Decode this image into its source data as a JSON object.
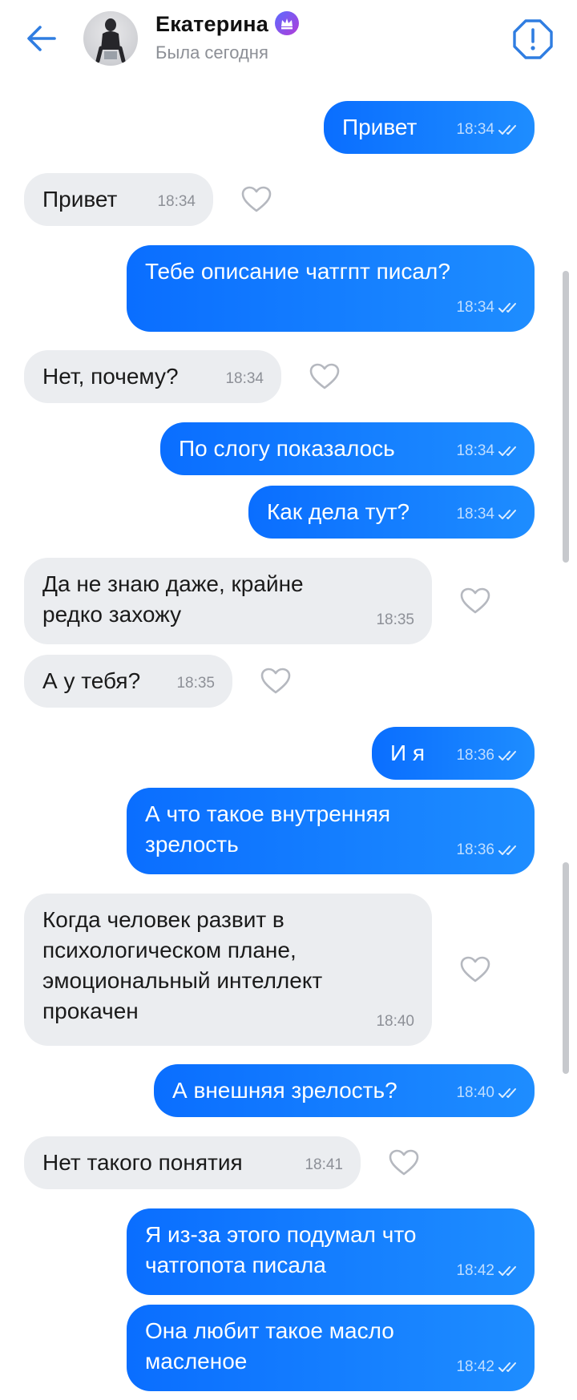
{
  "header": {
    "contact_name": "Екатерина",
    "status": "Была сегодня",
    "accent_color": "#2f7de1"
  },
  "messages": [
    {
      "dir": "out",
      "lines": [
        "Привет"
      ],
      "time": "18:34"
    },
    {
      "dir": "in",
      "lines": [
        "Привет"
      ],
      "time": "18:34"
    },
    {
      "dir": "out",
      "lines": [
        "Тебе описание чатгпт писал?"
      ],
      "time": "18:34"
    },
    {
      "dir": "in",
      "lines": [
        "Нет, почему?"
      ],
      "time": "18:34"
    },
    {
      "dir": "out",
      "lines": [
        "По слогу показалось"
      ],
      "time": "18:34"
    },
    {
      "dir": "out",
      "lines": [
        "Как дела тут?"
      ],
      "time": "18:34"
    },
    {
      "dir": "in",
      "lines": [
        "Да не знаю даже, крайне",
        "редко захожу"
      ],
      "time": "18:35"
    },
    {
      "dir": "in",
      "lines": [
        "А у тебя?"
      ],
      "time": "18:35"
    },
    {
      "dir": "out",
      "lines": [
        "И я"
      ],
      "time": "18:36"
    },
    {
      "dir": "out",
      "lines": [
        "А что такое внутренняя",
        "зрелость"
      ],
      "time": "18:36"
    },
    {
      "dir": "in",
      "lines": [
        "Когда человек развит в",
        "психологическом плане,",
        "эмоциональный интеллект",
        "прокачен"
      ],
      "time": "18:40"
    },
    {
      "dir": "out",
      "lines": [
        "А внешняя зрелость?"
      ],
      "time": "18:40"
    },
    {
      "dir": "in",
      "lines": [
        "Нет такого понятия"
      ],
      "time": "18:41"
    },
    {
      "dir": "out",
      "lines": [
        "Я из-за этого подумал что",
        "чатгопота писала"
      ],
      "time": "18:42"
    },
    {
      "dir": "out",
      "lines": [
        "Она любит такое масло",
        "масленое"
      ],
      "time": "18:42"
    }
  ]
}
